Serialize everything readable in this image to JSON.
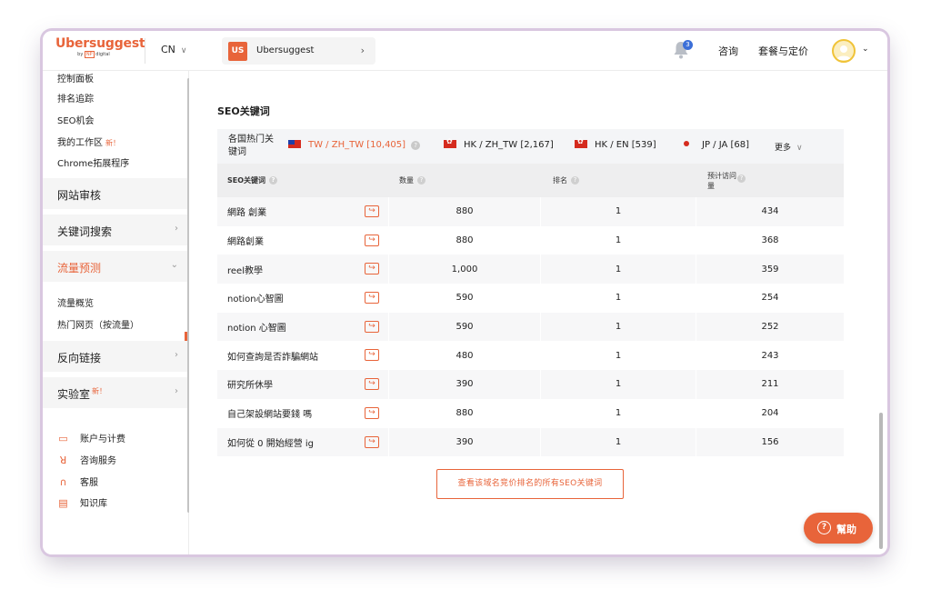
{
  "header": {
    "logo": "Ubersuggest",
    "logo_sub_by": "by",
    "logo_sub_np": "NP",
    "logo_sub_digital": "digital",
    "language": "CN",
    "project_badge": "US",
    "project_name": "Ubersuggest",
    "notification_count": "3",
    "consult": "咨询",
    "pricing": "套餐与定价"
  },
  "sidebar": {
    "sub_items_top": [
      "控制面板",
      "排名追踪",
      "SEO机会",
      "我的工作区",
      "Chrome拓展程序"
    ],
    "new_badge": "新！",
    "sections": {
      "site_audit": "网站审核",
      "keyword_research": "关键词搜索",
      "traffic_estimate": "流量预测",
      "backlinks": "反向链接",
      "labs": "实验室"
    },
    "traffic_sub": [
      "流量概览",
      "热门网页（按流量）"
    ],
    "bottom_items": [
      "账户与计费",
      "咨询服务",
      "客服",
      "知识库"
    ]
  },
  "main": {
    "section_title": "SEO关键词",
    "filter_label": "各国热门关键词",
    "filters": [
      {
        "label": "TW / ZH_TW [10,405]",
        "flag": "tw-flag-icon"
      },
      {
        "label": "HK / ZH_TW [2,167]",
        "flag": "hk-flag-icon"
      },
      {
        "label": "HK / EN [539]",
        "flag": "hk-flag-icon"
      },
      {
        "label": "JP / JA [68]",
        "flag": "jp-flag-icon"
      }
    ],
    "more": "更多",
    "table": {
      "headers": [
        "SEO关键词",
        "数量",
        "排名",
        "预计访问量"
      ],
      "rows": [
        {
          "keyword": "網路 創業",
          "volume": "880",
          "rank": "1",
          "visits": "434"
        },
        {
          "keyword": "網路創業",
          "volume": "880",
          "rank": "1",
          "visits": "368"
        },
        {
          "keyword": "reel教學",
          "volume": "1,000",
          "rank": "1",
          "visits": "359"
        },
        {
          "keyword": "notion心智圖",
          "volume": "590",
          "rank": "1",
          "visits": "254"
        },
        {
          "keyword": "notion 心智圖",
          "volume": "590",
          "rank": "1",
          "visits": "252"
        },
        {
          "keyword": "如何查詢是否詐騙網站",
          "volume": "480",
          "rank": "1",
          "visits": "243"
        },
        {
          "keyword": "研究所休學",
          "volume": "390",
          "rank": "1",
          "visits": "211"
        },
        {
          "keyword": "自己架設網站要錢 嗎",
          "volume": "880",
          "rank": "1",
          "visits": "204"
        },
        {
          "keyword": "如何從 0 開始經營 ig",
          "volume": "390",
          "rank": "1",
          "visits": "156"
        }
      ]
    },
    "view_all": "查看该域名竞价排名的所有SEO关键词",
    "help": "幫助"
  },
  "colors": {
    "accent": "#e8643a",
    "notification": "#3b6fd8"
  }
}
